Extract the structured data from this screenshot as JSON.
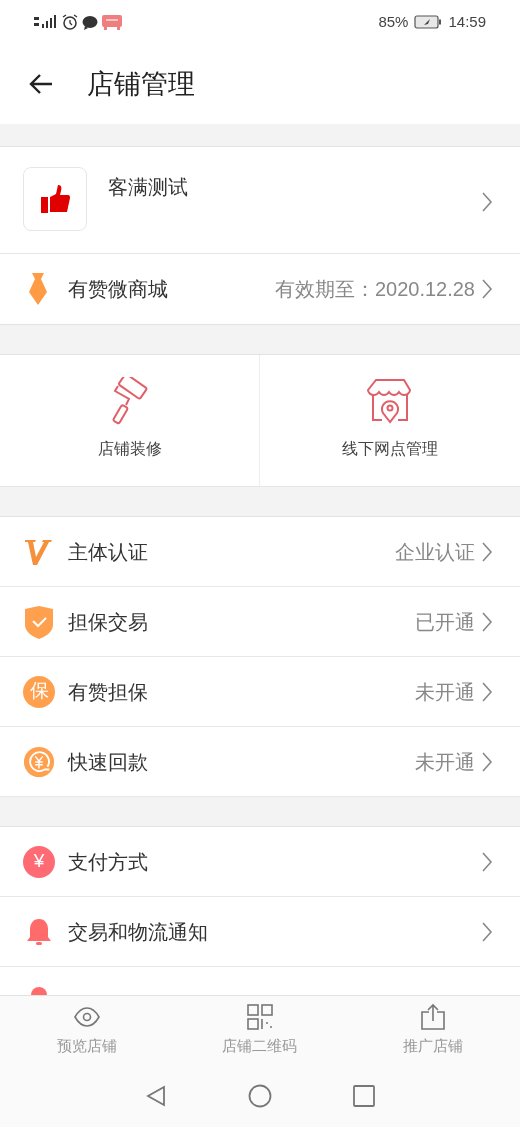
{
  "status_bar": {
    "battery": "85%",
    "time": "14:59"
  },
  "header": {
    "title": "店铺管理"
  },
  "shop": {
    "name": "客满测试"
  },
  "mall": {
    "label": "有赞微商城",
    "value": "有效期至：2020.12.28"
  },
  "tools": [
    {
      "kind": "roller",
      "label": "店铺装修"
    },
    {
      "kind": "store",
      "label": "线下网点管理"
    }
  ],
  "sections": [
    [
      {
        "kind": "v",
        "label": "主体认证",
        "value": "企业认证"
      },
      {
        "kind": "shield",
        "label": "担保交易",
        "value": "已开通"
      },
      {
        "kind": "char",
        "icon_text": "保",
        "label": "有赞担保",
        "value": "未开通"
      },
      {
        "kind": "refund",
        "label": "快速回款",
        "value": "未开通"
      }
    ],
    [
      {
        "kind": "yen",
        "icon_text": "¥",
        "label": "支付方式"
      },
      {
        "kind": "bell",
        "label": "交易和物流通知"
      },
      {
        "kind": "partial"
      }
    ]
  ],
  "bottom_tabs": [
    {
      "kind": "eye",
      "label": "预览店铺"
    },
    {
      "kind": "qr",
      "label": "店铺二维码"
    },
    {
      "kind": "share",
      "label": "推广店铺"
    }
  ]
}
